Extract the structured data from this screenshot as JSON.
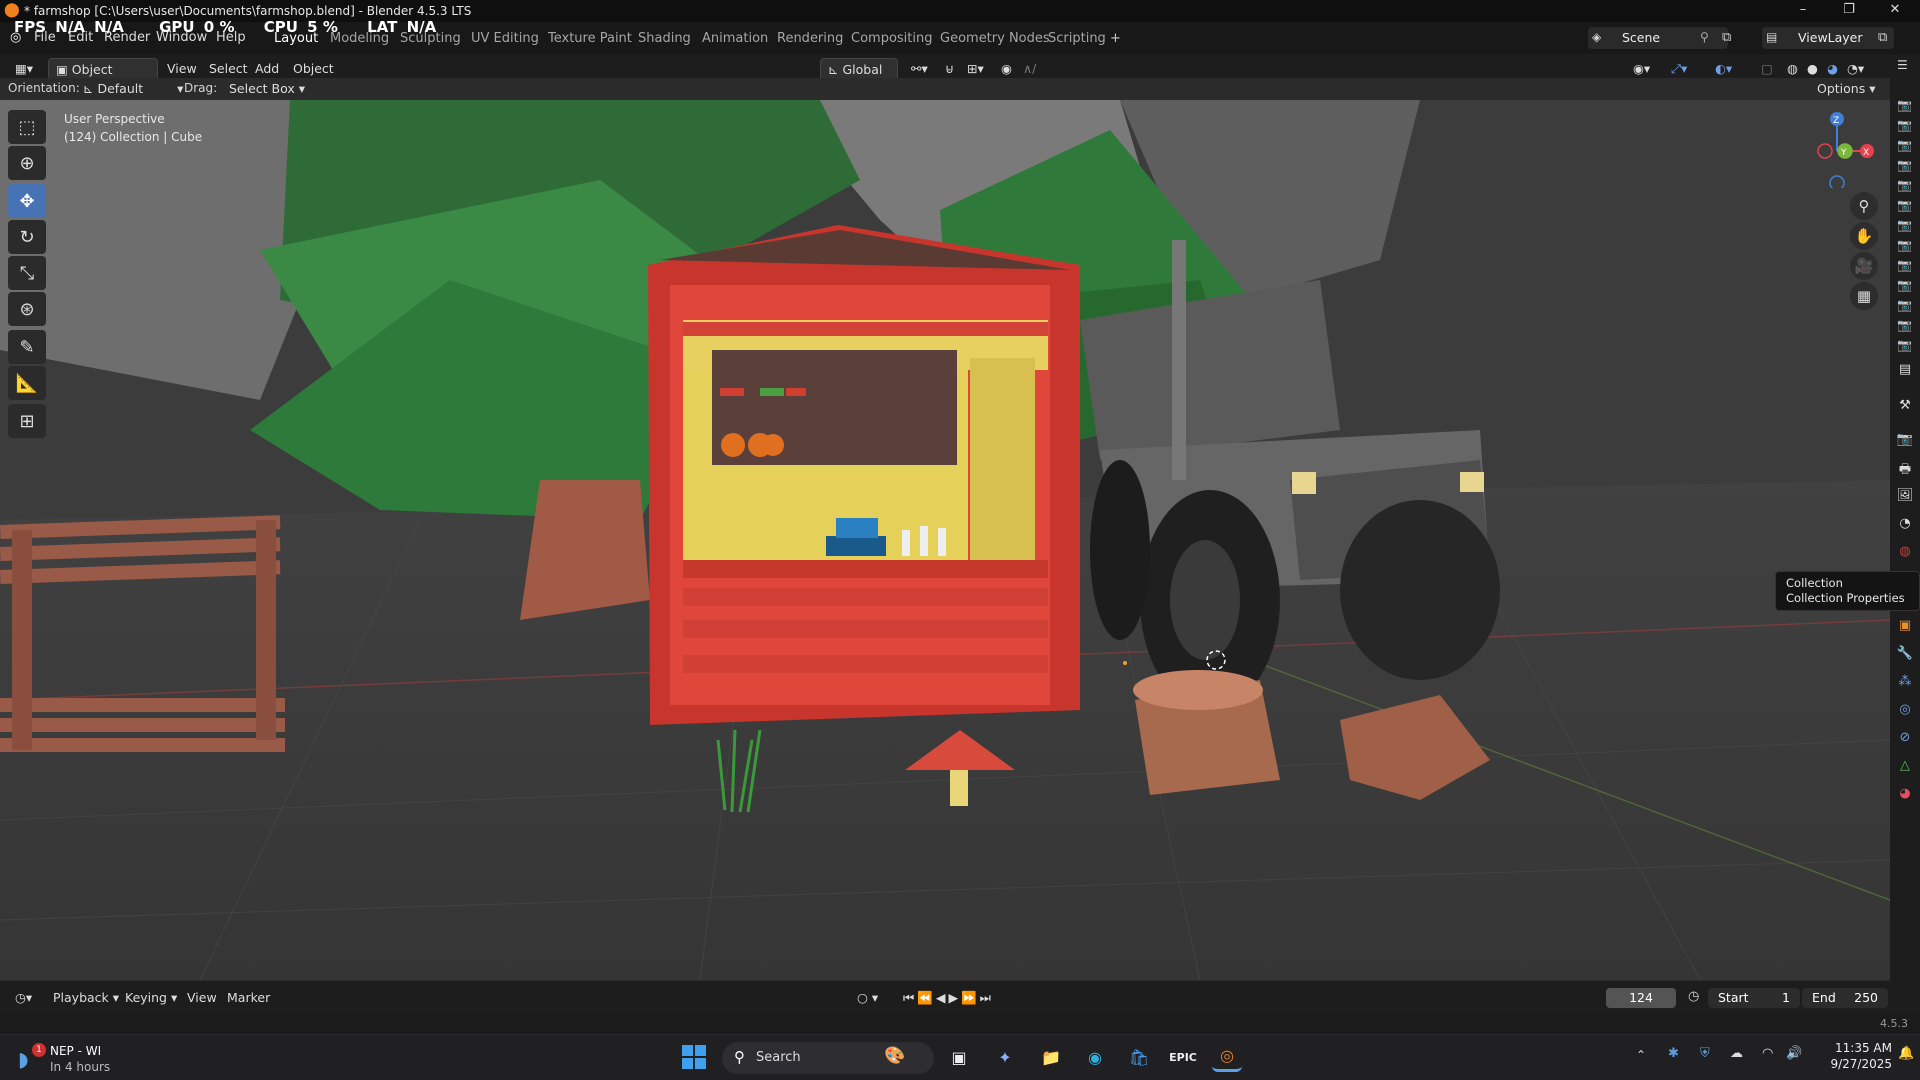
{
  "window": {
    "title": "* farmshop [C:\\Users\\user\\Documents\\farmshop.blend] - Blender 4.5.3 LTS",
    "minimize": "–",
    "maximize": "❐",
    "close": "✕"
  },
  "overlay_stats": {
    "fps_label": "FPS",
    "fps_value": "N/A",
    "fps_value2": "N/A",
    "gpu_label": "GPU",
    "gpu_value": "0 %",
    "cpu_label": "CPU",
    "cpu_value": "5 %",
    "lat_label": "LAT",
    "lat_value": "N/A"
  },
  "menus": [
    "File",
    "Edit",
    "Render",
    "Window",
    "Help"
  ],
  "workspaces": [
    {
      "label": "Layout",
      "active": true
    },
    {
      "label": "Modeling"
    },
    {
      "label": "Sculpting"
    },
    {
      "label": "UV Editing"
    },
    {
      "label": "Texture Paint"
    },
    {
      "label": "Shading"
    },
    {
      "label": "Animation"
    },
    {
      "label": "Rendering"
    },
    {
      "label": "Compositing"
    },
    {
      "label": "Geometry Nodes"
    },
    {
      "label": "Scripting"
    }
  ],
  "add_workspace": "+",
  "scene_label": "Scene",
  "viewlayer_label": "ViewLayer",
  "header": {
    "mode": "Object Mode",
    "view": "View",
    "select": "Select",
    "add": "Add",
    "object": "Object",
    "transform_orientation": "Global"
  },
  "tool_settings": {
    "orientation_label": "Orientation:",
    "orientation_value": "Default",
    "drag_label": "Drag:",
    "drag_value": "Select Box",
    "options": "Options"
  },
  "viewport": {
    "perspective": "User Perspective",
    "collection_line": "(124) Collection | Cube"
  },
  "gizmo": {
    "z": "Z",
    "y": "Y",
    "x": "X",
    "colors": {
      "x": "#e8404c",
      "y": "#7ab83a",
      "z": "#3f7fd6"
    }
  },
  "tooltip": {
    "title": "Collection",
    "subtitle": "Collection Properties"
  },
  "timeline": {
    "playback": "Playback",
    "keying": "Keying",
    "view": "View",
    "marker": "Marker",
    "current_frame": "124",
    "start_label": "Start",
    "start_value": "1",
    "end_label": "End",
    "end_value": "250"
  },
  "status": {
    "version": "4.5.3"
  },
  "taskbar": {
    "weather_badge": "1",
    "weather_title": "NEP - WI",
    "weather_subtitle": "In 4 hours",
    "search_placeholder": "Search",
    "time": "11:35 AM",
    "date": "9/27/2025"
  }
}
